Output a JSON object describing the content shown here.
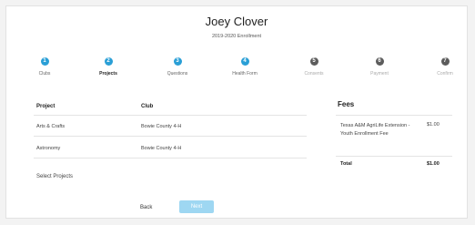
{
  "header": {
    "name": "Joey Clover",
    "subtitle": "2019-2020 Enrollment"
  },
  "steps": [
    {
      "number": "1",
      "label": "Clubs",
      "state": "done"
    },
    {
      "number": "2",
      "label": "Projects",
      "state": "active"
    },
    {
      "number": "3",
      "label": "Questions",
      "state": "done"
    },
    {
      "number": "4",
      "label": "Health Form",
      "state": "done"
    },
    {
      "number": "5",
      "label": "Consents",
      "state": "todo"
    },
    {
      "number": "6",
      "label": "Payment",
      "state": "todo"
    },
    {
      "number": "7",
      "label": "Confirm",
      "state": "todo"
    }
  ],
  "table": {
    "project_header": "Project",
    "club_header": "Club",
    "rows": [
      {
        "project": "Arts & Crafts",
        "club": "Bowie County 4-H"
      },
      {
        "project": "Astronomy",
        "club": "Bowie County 4-H"
      }
    ],
    "select_projects_link": "Select Projects"
  },
  "fees": {
    "title": "Fees",
    "items": [
      {
        "description": "Texas A&M AgriLife Extension - Youth Enrollment Fee",
        "amount": "$1.00"
      }
    ],
    "total_label": "Total",
    "total_amount": "$1.00"
  },
  "footer": {
    "back_label": "Back",
    "next_label": "Next"
  },
  "colors": {
    "accent": "#2a9fd6",
    "next_button": "#9ed7f2",
    "pending_step": "#5c5c5c"
  }
}
